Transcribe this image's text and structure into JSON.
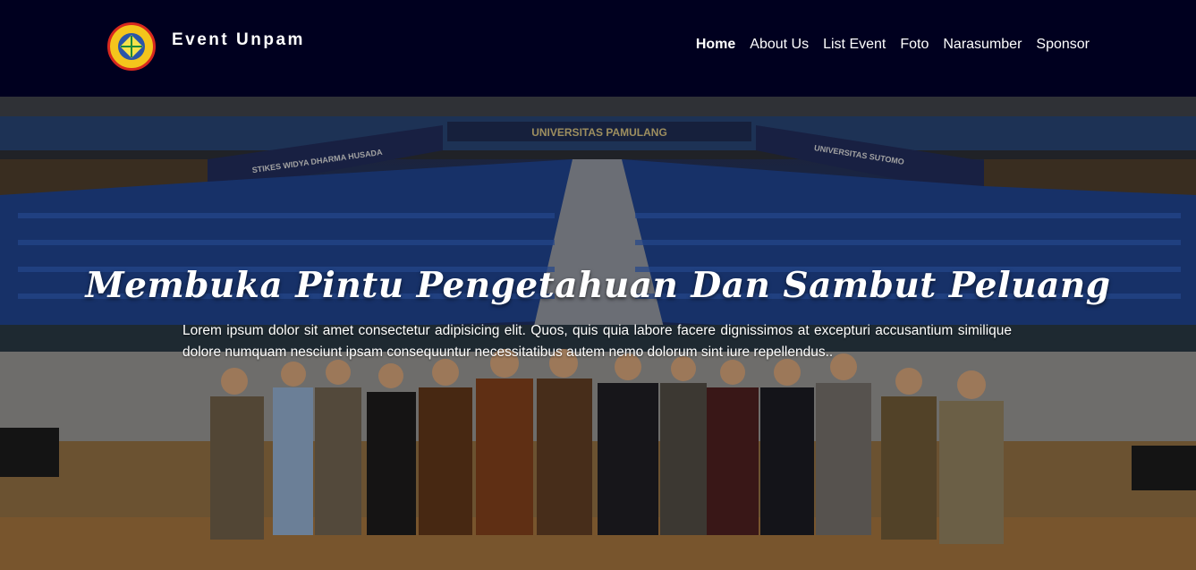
{
  "brand": {
    "name": "Event Unpam",
    "logo_icon": "university-logo-icon"
  },
  "nav": {
    "items": [
      {
        "label": "Home",
        "active": true
      },
      {
        "label": "About Us",
        "active": false
      },
      {
        "label": "List Event",
        "active": false
      },
      {
        "label": "Foto",
        "active": false
      },
      {
        "label": "Narasumber",
        "active": false
      },
      {
        "label": "Sponsor",
        "active": false
      }
    ]
  },
  "hero": {
    "title": "Membuka Pintu Pengetahuan Dan Sambut Peluang",
    "text": "Lorem ipsum dolor sit amet consectetur adipisicing elit. Quos, quis quia labore facere dignissimos at excepturi accusantium similique dolore numquam nesciunt ipsam consequuntur necessitatibus autem nemo dolorum sint iure repellendus..",
    "banner_texts": [
      "UNIVERSITAS PAMULANG",
      "STIKES WIDYA DHARMA HUSADA",
      "UNIVERSITAS SUTOMO"
    ]
  },
  "colors": {
    "navbar_bg": "#00001f",
    "nav_text": "#ffffff",
    "logo_yellow": "#f4c51c",
    "logo_red": "#d8281e"
  }
}
